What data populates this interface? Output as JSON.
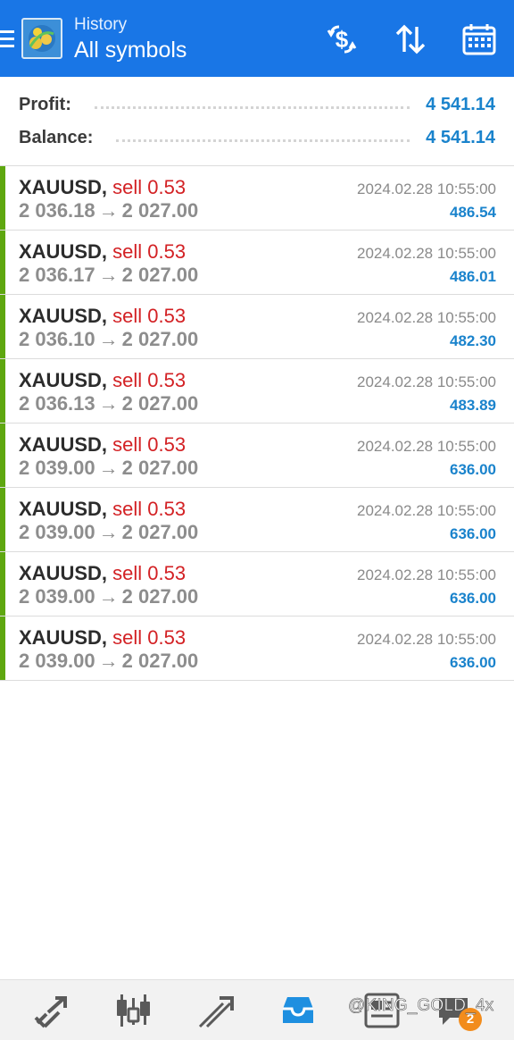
{
  "header": {
    "subtitle": "History",
    "title": "All symbols",
    "icons": [
      "menu-icon",
      "app-logo",
      "dollar-refresh-icon",
      "sort-icon",
      "calendar-icon"
    ]
  },
  "summary": {
    "profit_label": "Profit:",
    "profit_value": "4 541.14",
    "balance_label": "Balance:",
    "balance_value": "4 541.14"
  },
  "deals": [
    {
      "symbol": "XAUUSD,",
      "type": "sell 0.53",
      "open": "2 036.18",
      "arrow": "→",
      "close": "2 027.00",
      "time": "2024.02.28 10:55:00",
      "profit": "486.54"
    },
    {
      "symbol": "XAUUSD,",
      "type": "sell 0.53",
      "open": "2 036.17",
      "arrow": "→",
      "close": "2 027.00",
      "time": "2024.02.28 10:55:00",
      "profit": "486.01"
    },
    {
      "symbol": "XAUUSD,",
      "type": "sell 0.53",
      "open": "2 036.10",
      "arrow": "→",
      "close": "2 027.00",
      "time": "2024.02.28 10:55:00",
      "profit": "482.30"
    },
    {
      "symbol": "XAUUSD,",
      "type": "sell 0.53",
      "open": "2 036.13",
      "arrow": "→",
      "close": "2 027.00",
      "time": "2024.02.28 10:55:00",
      "profit": "483.89"
    },
    {
      "symbol": "XAUUSD,",
      "type": "sell 0.53",
      "open": "2 039.00",
      "arrow": "→",
      "close": "2 027.00",
      "time": "2024.02.28 10:55:00",
      "profit": "636.00"
    },
    {
      "symbol": "XAUUSD,",
      "type": "sell 0.53",
      "open": "2 039.00",
      "arrow": "→",
      "close": "2 027.00",
      "time": "2024.02.28 10:55:00",
      "profit": "636.00"
    },
    {
      "symbol": "XAUUSD,",
      "type": "sell 0.53",
      "open": "2 039.00",
      "arrow": "→",
      "close": "2 027.00",
      "time": "2024.02.28 10:55:00",
      "profit": "636.00"
    },
    {
      "symbol": "XAUUSD,",
      "type": "sell 0.53",
      "open": "2 039.00",
      "arrow": "→",
      "close": "2 027.00",
      "time": "2024.02.28 10:55:00",
      "profit": "636.00"
    }
  ],
  "bottom_nav": {
    "items": [
      "quotes-icon",
      "chart-icon",
      "trade-icon",
      "history-icon",
      "news-icon",
      "chat-icon"
    ],
    "active": "history-icon",
    "chat_badge": "2"
  },
  "watermark": "@KING_GOLD_4x",
  "colors": {
    "header_bg": "#1976e6",
    "sell": "#d32124",
    "profit": "#1a83cc",
    "deal_bar": "#5ea70f",
    "active_nav": "#1e8fe0",
    "badge": "#f28c1c"
  }
}
